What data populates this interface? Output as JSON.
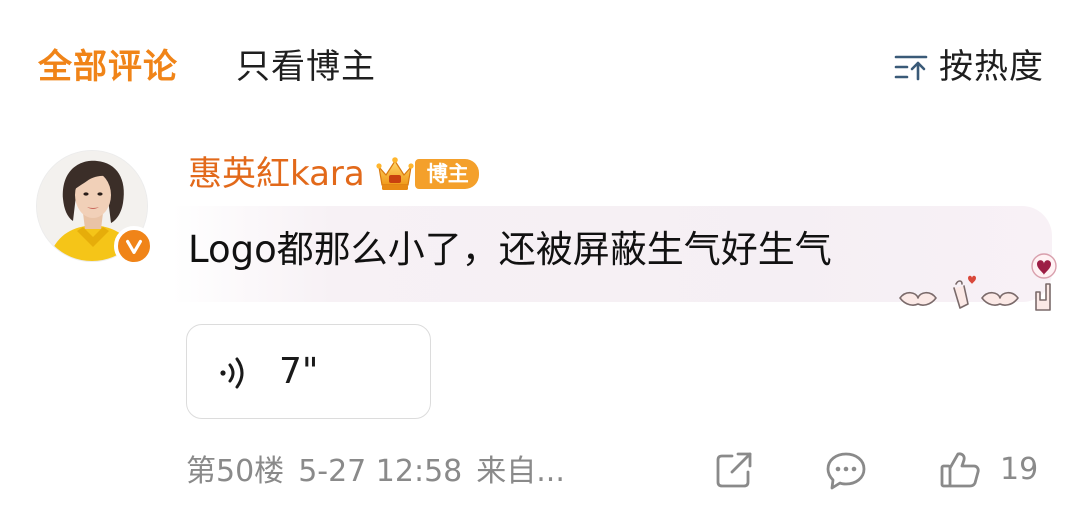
{
  "tabs": {
    "all_comments": "全部评论",
    "blogger_only": "只看博主"
  },
  "sort": {
    "label": "按热度",
    "icon": "sort-icon"
  },
  "comment": {
    "username": "惠英紅kara",
    "role_badge": "博主",
    "text": "Logo都那么小了，还被屏蔽生气好生气",
    "voice": {
      "duration": "7\""
    },
    "meta": {
      "floor": "第50楼",
      "time": "5-27 12:58",
      "source": "来自..."
    },
    "actions": {
      "like_count": "19"
    }
  },
  "colors": {
    "accent": "#f08418",
    "username": "#e2691a",
    "muted": "#8a8a8a",
    "badge": "#f4a02b"
  }
}
